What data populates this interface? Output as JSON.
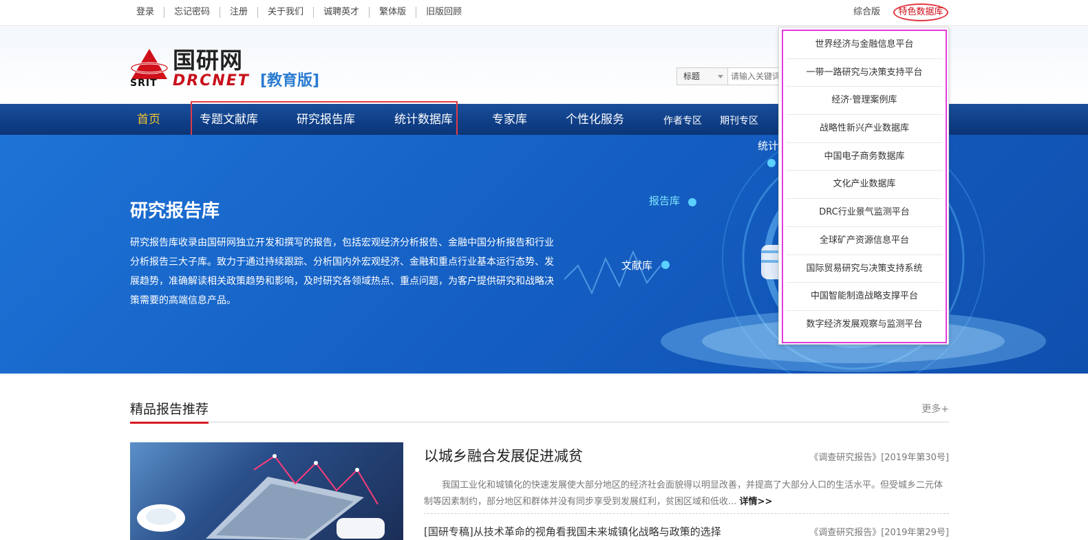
{
  "topbar": {
    "links": [
      "登录",
      "忘记密码",
      "注册",
      "关于我们",
      "诚聘英才",
      "繁体版",
      "旧版回顾"
    ],
    "comprehensive": "综合版",
    "special_db": "特色数据库"
  },
  "logo": {
    "cn": "国研网",
    "srit": "SRIT",
    "drcnet": "DRCNET",
    "edition": "[教育版]"
  },
  "search": {
    "field": "标题",
    "placeholder": "请输入关键词"
  },
  "nav": {
    "home": "首页",
    "items": [
      "专题文献库",
      "研究报告库",
      "统计数据库",
      "专家库",
      "个性化服务"
    ],
    "small_items": [
      "作者专区",
      "期刊专区"
    ]
  },
  "banner": {
    "title": "研究报告库",
    "desc": "研究报告库收录由国研网独立开发和撰写的报告，包括宏观经济分析报告、金融中国分析报告和行业分析报告三大子库。致力于通过持续跟踪、分析国内外宏观经济、金融和重点行业基本运行态势、发展趋势，准确解读相关政策趋势和影响，及时研究各领域热点、重点问题，为客户提供研究和战略决策需要的高端信息产品。",
    "labels": {
      "stats": "统计",
      "report": "报告库",
      "literature": "文献库"
    }
  },
  "dropdown": {
    "items": [
      "世界经济与金融信息平台",
      "一带一路研究与决策支持平台",
      "经济·管理案例库",
      "战略性新兴产业数据库",
      "中国电子商务数据库",
      "文化产业数据库",
      "DRC行业景气监测平台",
      "全球矿产资源信息平台",
      "国际贸易研究与决策支持系统",
      "中国智能制造战略支撑平台",
      "数字经济发展观察与监测平台"
    ]
  },
  "section": {
    "title": "精品报告推荐",
    "more": "更多+"
  },
  "articles": [
    {
      "title": "以城乡融合发展促进减贫",
      "source": "《调查研究报告》[2019年第30号]",
      "body": "我国工业化和城镇化的快速发展使大部分地区的经济社会面貌得以明显改善，并提高了大部分人口的生活水平。但受城乡二元体制等因素制约，部分地区和群体并没有同步享受到发展红利，贫困区域和低收...",
      "more": "详情>>"
    },
    {
      "title": "[国研专稿]从技术革命的视角看我国未来城镇化战略与政策的选择",
      "source": "《调查研究报告》[2019年第29号]"
    }
  ]
}
